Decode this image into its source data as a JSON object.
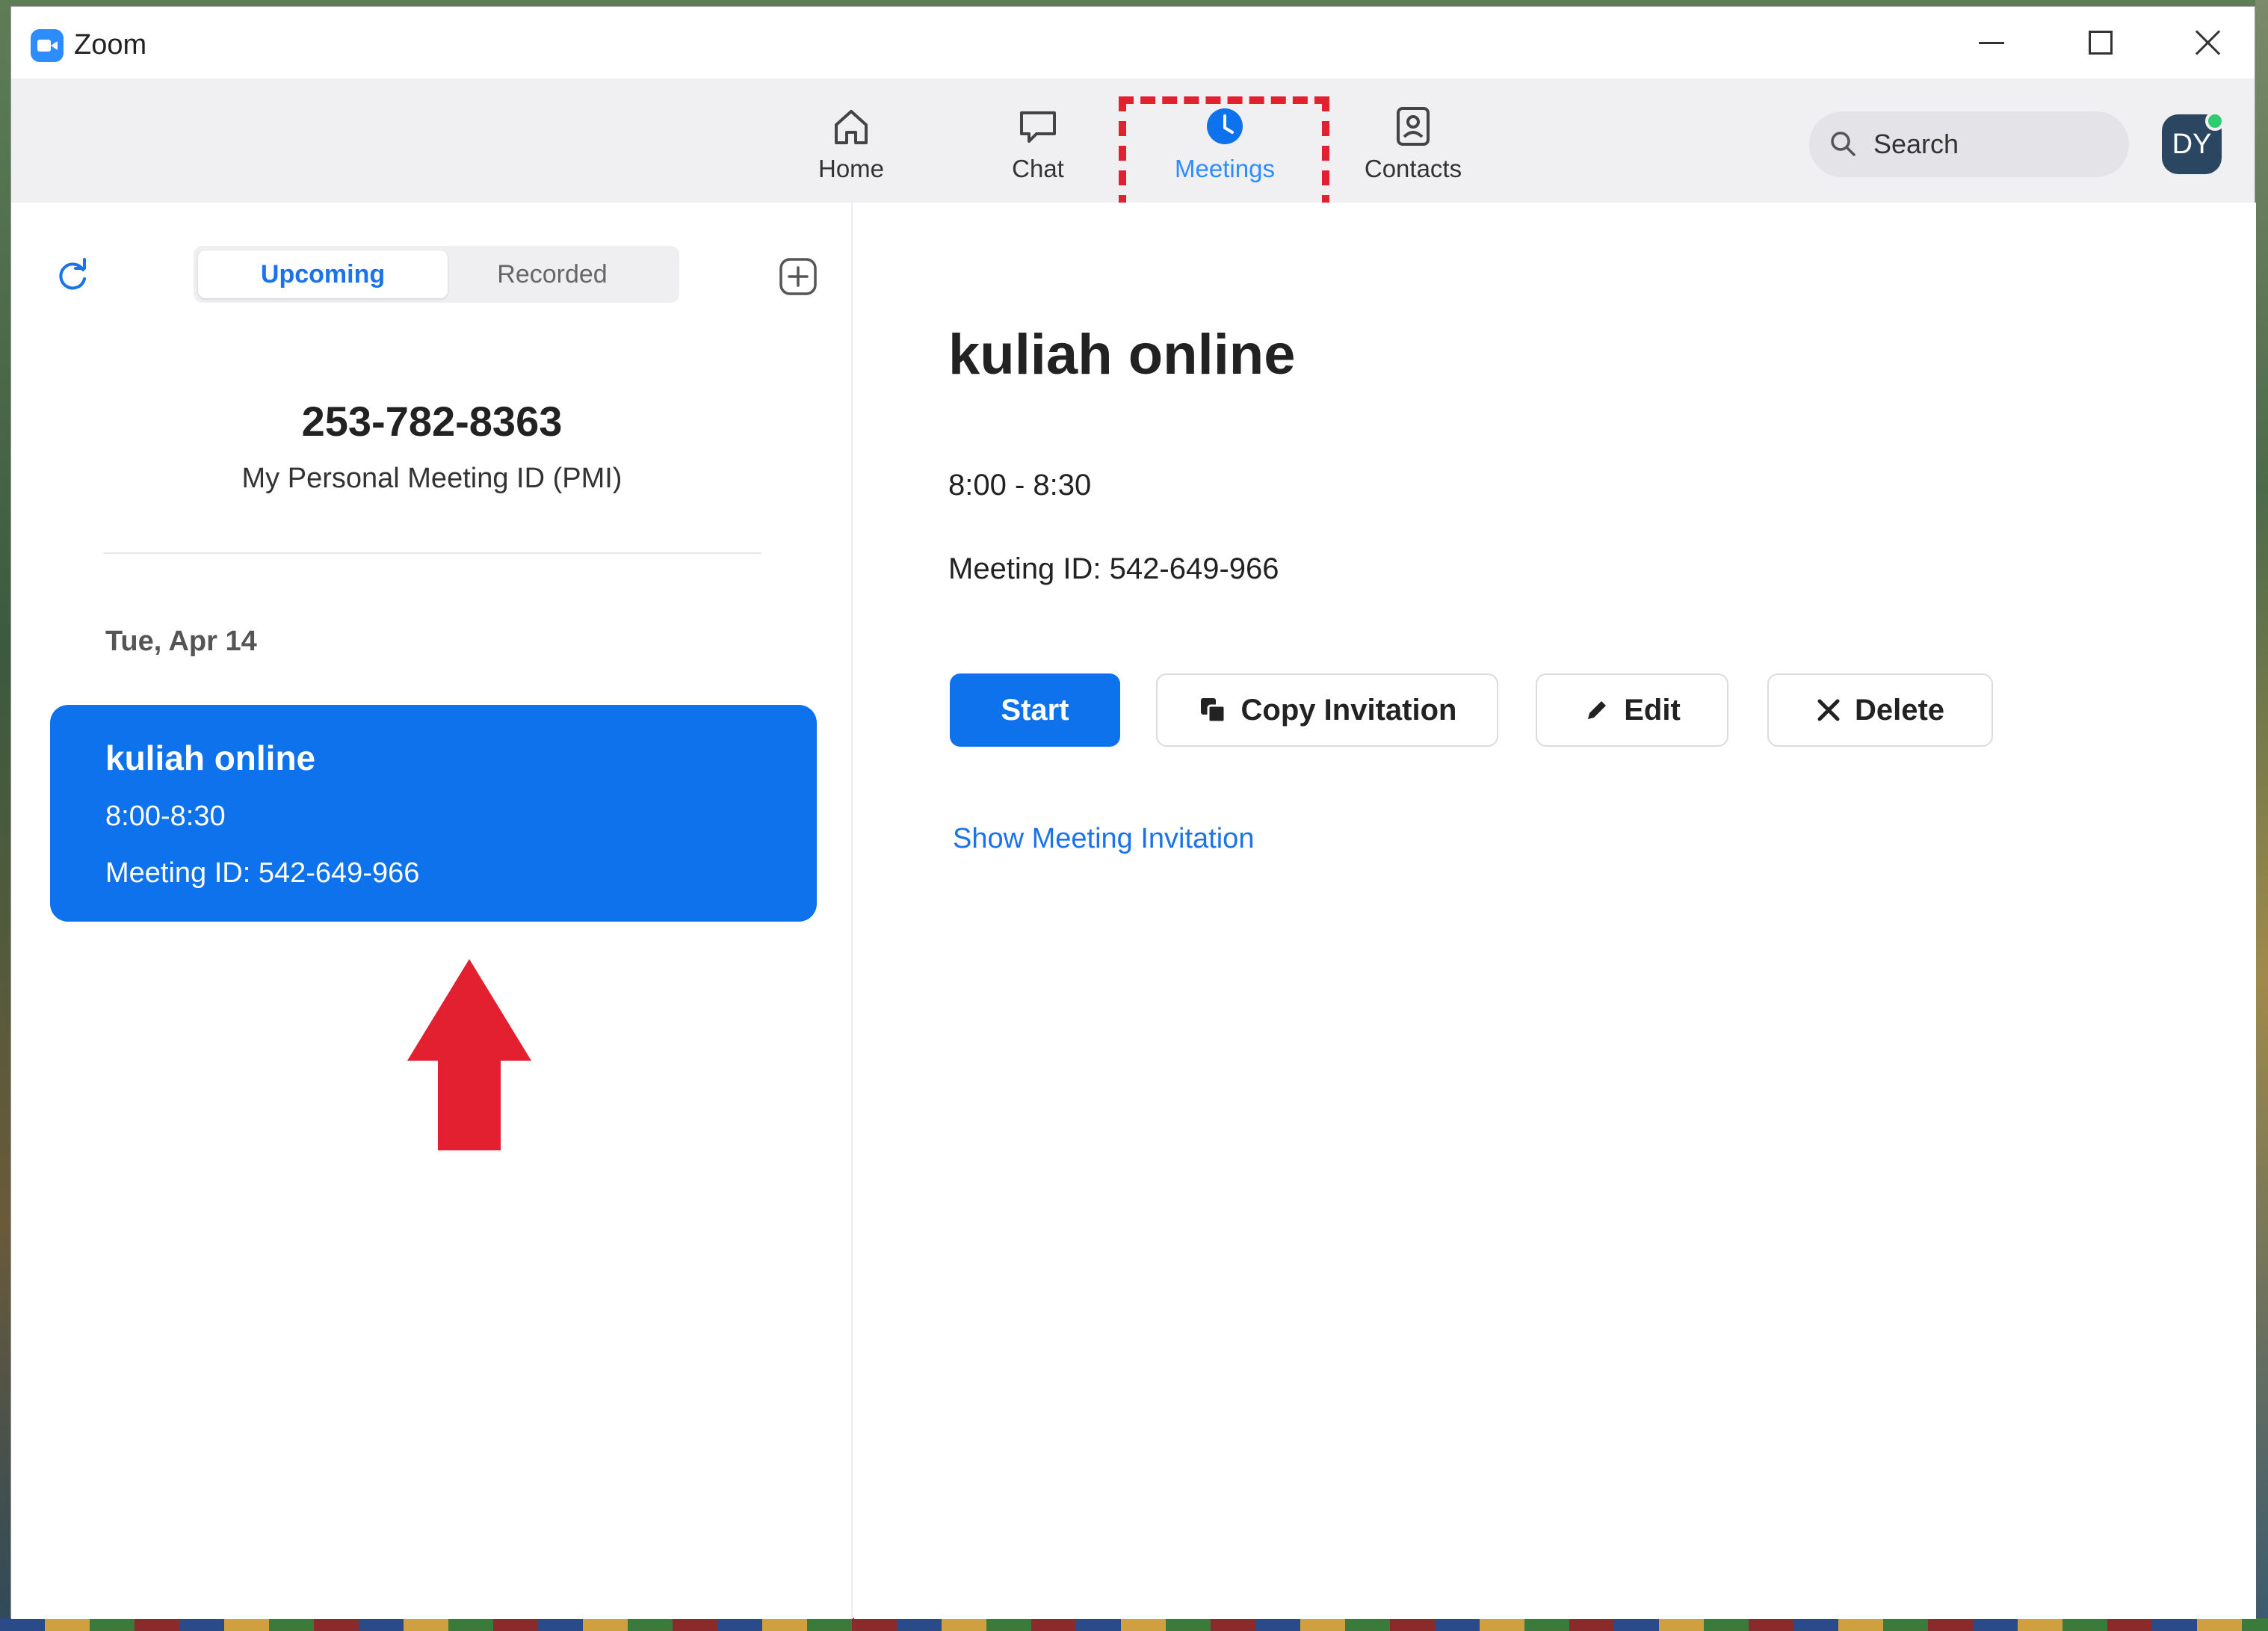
{
  "window": {
    "title": "Zoom"
  },
  "nav": {
    "home": "Home",
    "chat": "Chat",
    "meetings": "Meetings",
    "contacts": "Contacts",
    "active": "Meetings"
  },
  "search": {
    "label": "Search"
  },
  "user": {
    "initials": "DY",
    "status_color": "#2ecc71"
  },
  "left": {
    "tabs": {
      "upcoming": "Upcoming",
      "recorded": "Recorded",
      "active": "Upcoming"
    },
    "pmi": {
      "number": "253-782-8363",
      "label": "My Personal Meeting ID (PMI)"
    },
    "date_header": "Tue, Apr 14",
    "meetings": [
      {
        "title": "kuliah online",
        "time": "8:00-8:30",
        "meeting_id": "Meeting ID: 542-649-966",
        "selected": true
      }
    ]
  },
  "detail": {
    "title": "kuliah online",
    "time": "8:00 - 8:30",
    "meeting_id": "Meeting ID: 542-649-966",
    "buttons": {
      "start": "Start",
      "copy": "Copy Invitation",
      "edit": "Edit",
      "delete": "Delete"
    },
    "show_invitation": "Show Meeting Invitation"
  },
  "colors": {
    "accent": "#0e72ed",
    "link": "#1a73e8",
    "annotation": "#e3202f"
  }
}
